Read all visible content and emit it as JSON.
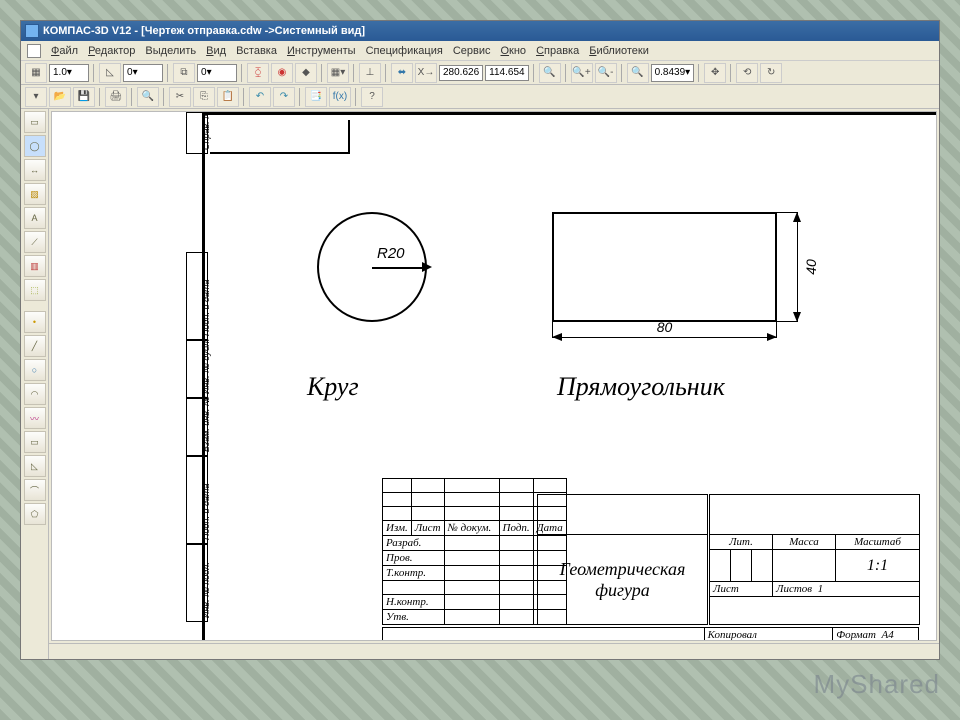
{
  "title": "КОМПАС-3D V12 - [Чертеж отправка.cdw ->Системный вид]",
  "menu": {
    "file": "Файл",
    "editor": "Редактор",
    "select": "Выделить",
    "view": "Вид",
    "insert": "Вставка",
    "tools": "Инструменты",
    "spec": "Спецификация",
    "service": "Сервис",
    "window": "Окно",
    "help": "Справка",
    "libs": "Библиотеки"
  },
  "toolbar": {
    "scale_step": "1.0",
    "angle": "0",
    "other": "0",
    "coord_x": "280.626",
    "coord_y": "114.654",
    "zoom": "0.8439"
  },
  "drawing": {
    "circle_radius_label": "R20",
    "circle_label": "Круг",
    "rect_label": "Прямоугольник",
    "dim_width": "80",
    "dim_height": "40"
  },
  "stamp": {
    "side_labels": [
      "Справ. №",
      "Подп. и дата",
      "Инв. № дубл.",
      "Взам. инв. №",
      "Подп. и дата",
      "Инв. № подл."
    ],
    "cols": {
      "izm": "Изм.",
      "list": "Лист",
      "ndoc": "№ докум.",
      "podp": "Подп.",
      "data": "Дата"
    },
    "rows": {
      "razrab": "Разраб.",
      "prov": "Пров.",
      "tkontr": "Т.контр.",
      "nkontr": "Н.контр.",
      "utv": "Утв."
    },
    "main_title": "Геометрическая фигура",
    "lit": "Лит.",
    "massa": "Масса",
    "mashtab": "Масштаб",
    "scale_val": "1:1",
    "list_label": "Лист",
    "listov_label": "Листов",
    "listov_val": "1",
    "kopiroval": "Копировал",
    "format": "Формат",
    "format_val": "A4"
  },
  "watermark": "MyShared"
}
